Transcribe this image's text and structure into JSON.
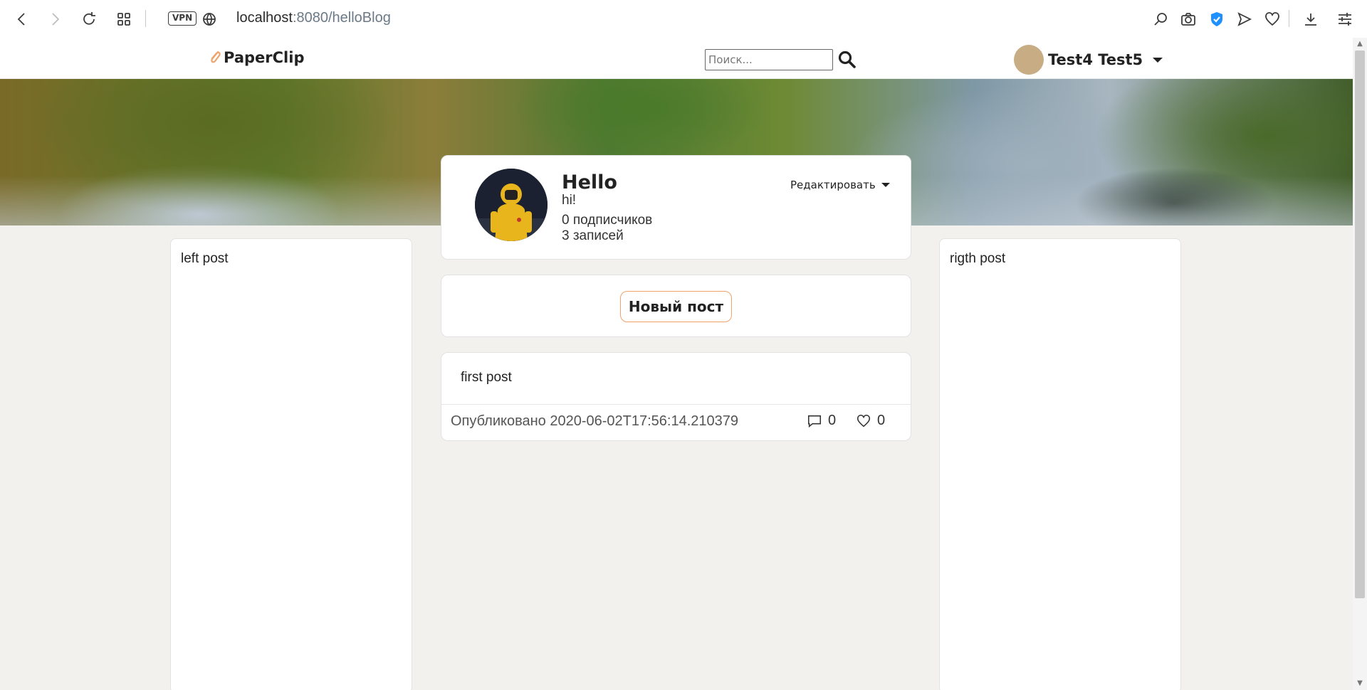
{
  "browser": {
    "vpn_label": "VPN",
    "url_host": "localhost",
    "url_rest": ":8080/helloBlog"
  },
  "header": {
    "logo_text": "PaperClip",
    "search_placeholder": "Поиск...",
    "user_name": "Test4 Test5"
  },
  "profile": {
    "name": "Hello",
    "bio": "hi!",
    "followers": "0 подписчиков",
    "posts_count": "3 записей",
    "edit_label": "Редактировать"
  },
  "new_post": {
    "button_label": "Новый пост"
  },
  "posts": [
    {
      "title": "first post",
      "published": "Опубликовано 2020-06-02T17:56:14.210379",
      "comments": "0",
      "likes": "0"
    }
  ],
  "sidebar": {
    "left_text": "left post",
    "right_text": "rigth post"
  },
  "colors": {
    "accent": "#f0a36a",
    "page_bg": "#f2f1ee",
    "avatar_placeholder": "#c7ac84"
  }
}
